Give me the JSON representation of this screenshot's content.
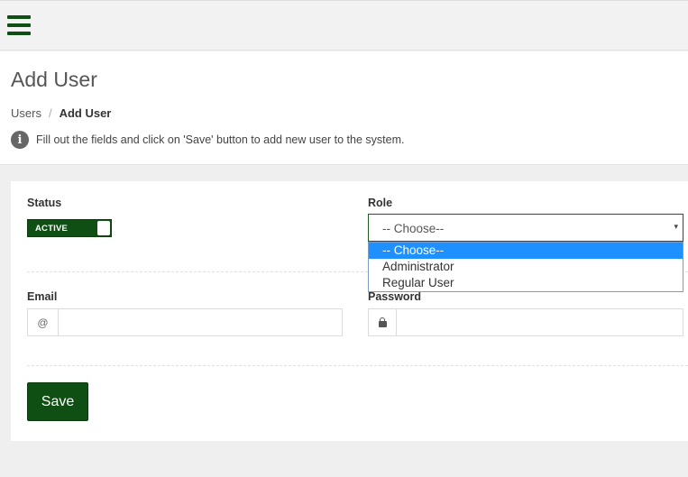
{
  "topbar": {
    "menu_icon": "hamburger-menu-icon"
  },
  "header": {
    "title": "Add User",
    "breadcrumb": {
      "parent": "Users",
      "separator": "/",
      "current": "Add User"
    },
    "info_icon": "info-circle-icon",
    "info_text": "Fill out the fields and click on 'Save' button to add new user to the system."
  },
  "form": {
    "status": {
      "label": "Status",
      "toggle_text": "ACTIVE",
      "checked": true
    },
    "role": {
      "label": "Role",
      "selected": "-- Choose--",
      "arrow": "▾",
      "options": [
        "-- Choose--",
        "Administrator",
        "Regular User"
      ],
      "highlighted_option": "-- Choose--"
    },
    "email": {
      "label": "Email",
      "addon": "@",
      "value": "",
      "placeholder": ""
    },
    "password": {
      "label": "Password",
      "addon_icon": "lock-icon",
      "value": "",
      "placeholder": ""
    },
    "save_label": "Save"
  },
  "colors": {
    "brand_green": "#0f4f14",
    "dropdown_highlight": "#1e90ff",
    "page_background": "#efefef"
  }
}
